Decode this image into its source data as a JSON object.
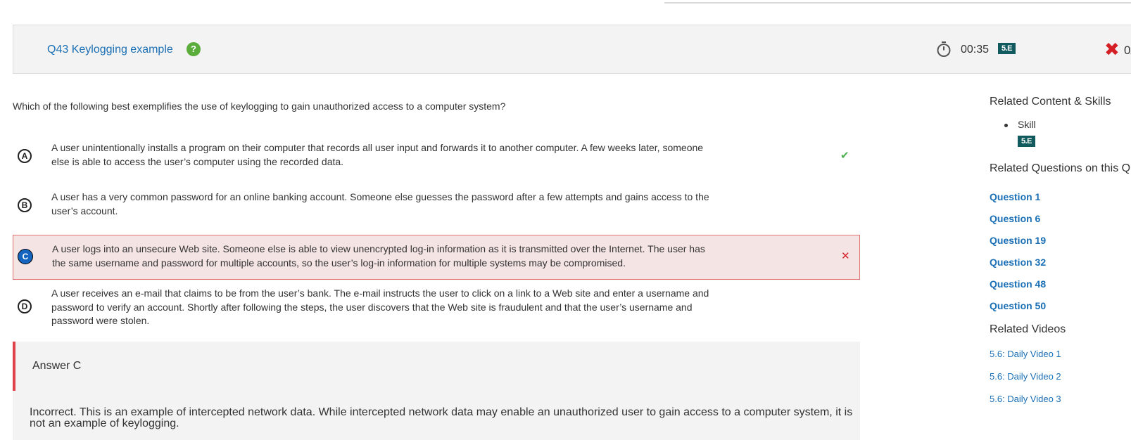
{
  "header": {
    "title": "Q43 Keylogging example",
    "help_icon": "question-mark",
    "timer": "00:35",
    "skill_badge": "5.E",
    "status_icon": "x-mark",
    "score": "0/"
  },
  "question": {
    "prompt": "Which of the following best exemplifies the use of keylogging to gain unauthorized access to a computer system?"
  },
  "choices": [
    {
      "letter": "A",
      "text": "A user unintentionally installs a program on their computer that records all user input and forwards it to another computer. A few weeks later, someone else is able to access the user’s computer using the recorded data.",
      "mark": "✔"
    },
    {
      "letter": "B",
      "text": "A user has a very common password for an online banking account. Someone else guesses the password after a few attempts and gains access to the user’s account.",
      "mark": ""
    },
    {
      "letter": "C",
      "text": "A user logs into an unsecure Web site. Someone else is able to view unencrypted log-in information as it is transmitted over the Internet. The user has the same username and password for multiple accounts, so the user’s log-in information for multiple systems may be compromised.",
      "mark": "✕"
    },
    {
      "letter": "D",
      "text": "A user receives an e-mail that claims to be from the user’s bank. The e-mail instructs the user to click on a link to a Web site and enter a username and password to verify an account. Shortly after following the steps, the user discovers that the Web site is fraudulent and that the user’s username and password were stolen.",
      "mark": ""
    }
  ],
  "feedback": {
    "answer": "Answer C",
    "explanation": "Incorrect. This is an example of intercepted network data. While intercepted network data may enable an unauthorized user to gain access to a computer system, it is not an example of keylogging."
  },
  "sidebar": {
    "related_content_title": "Related Content & Skills",
    "skill_label": "Skill",
    "skill_badge": "5.E",
    "related_questions_title": "Related Questions on this Qu",
    "questions": [
      "Question 1",
      "Question 6",
      "Question 19",
      "Question 32",
      "Question 48",
      "Question 50"
    ],
    "related_videos_title": "Related Videos",
    "videos": [
      "5.6: Daily Video 1",
      "5.6: Daily Video 2",
      "5.6: Daily Video 3"
    ]
  },
  "colors": {
    "link": "#1a6fb5",
    "correct": "#4caf50",
    "incorrect": "#d51f26",
    "badge": "#115b5e",
    "selected_choice": "#1565c0"
  }
}
